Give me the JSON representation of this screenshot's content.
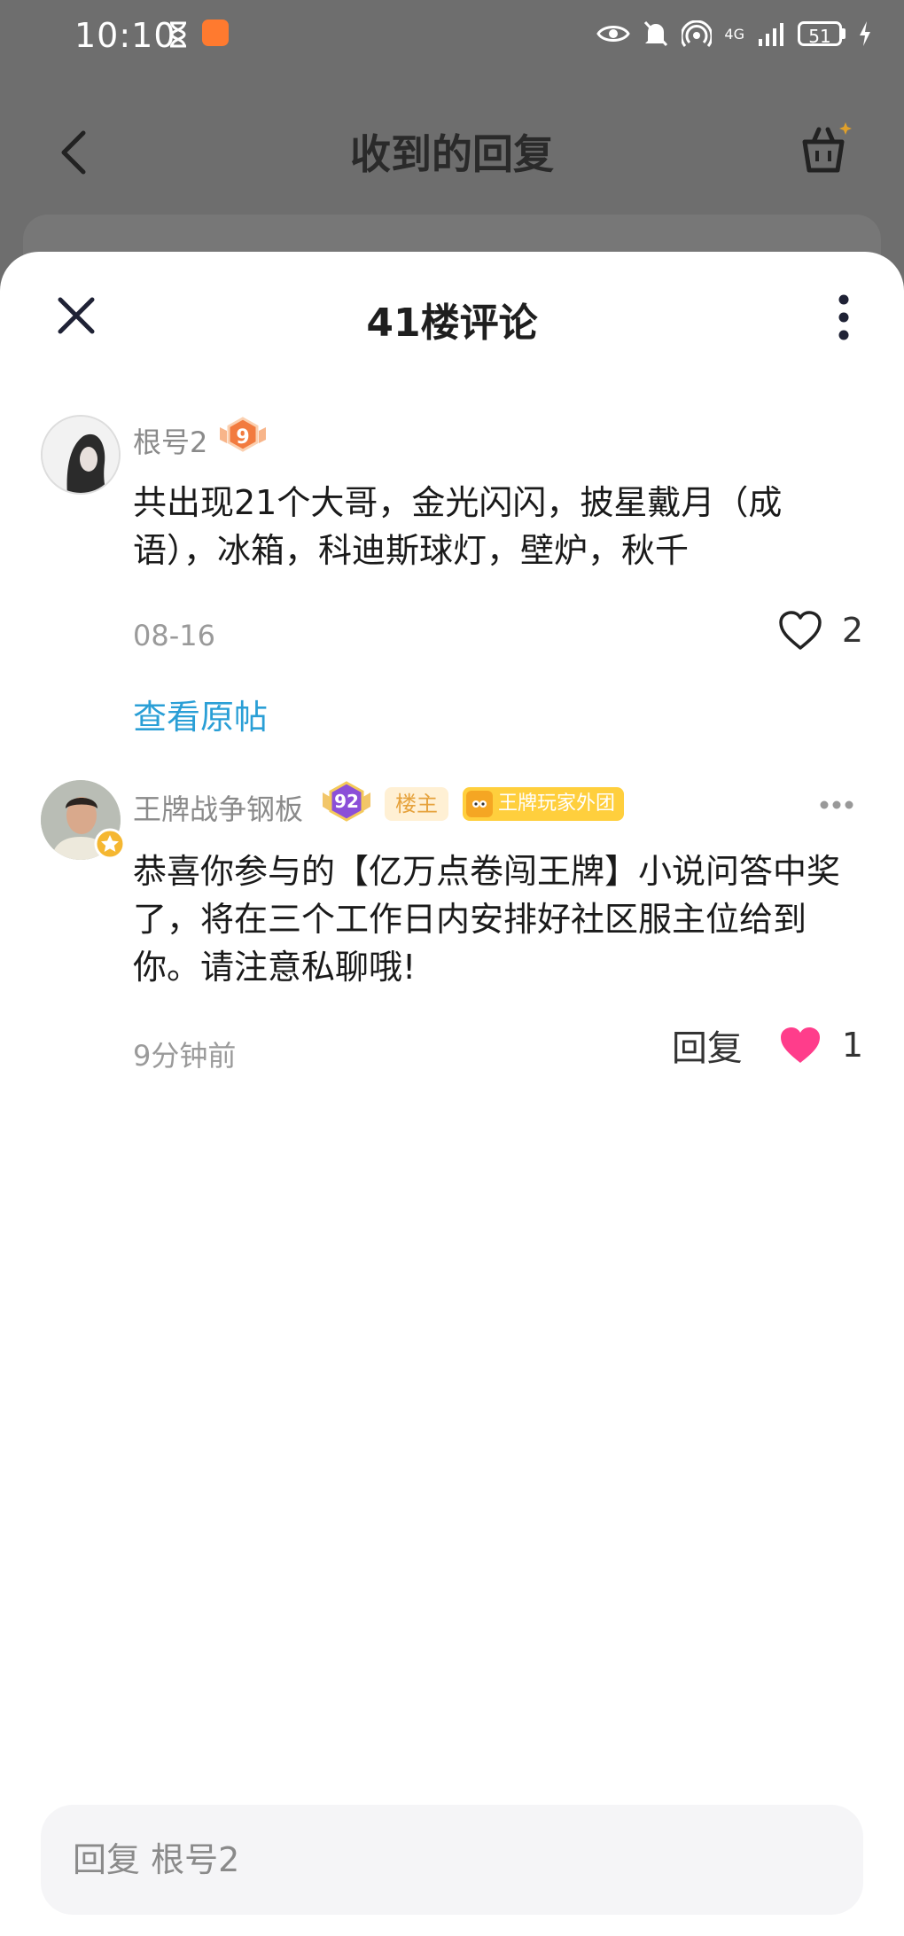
{
  "status_bar": {
    "time": "10:10",
    "battery": "51",
    "network": "4G"
  },
  "background_page": {
    "title": "收到的回复"
  },
  "sheet": {
    "title": "41楼评论"
  },
  "comments": [
    {
      "username": "根号2",
      "level": "9",
      "text": "共出现21个大哥，金光闪闪，披星戴月（成语），冰箱，科迪斯球灯，壁炉，秋千",
      "time": "08-16",
      "likes": "2",
      "liked": false,
      "view_original": "查看原帖"
    },
    {
      "username": "王牌战争钢板",
      "level": "92",
      "owner_tag": "楼主",
      "team_tag": "王牌玩家外团",
      "text": "恭喜你参与的【亿万点卷闯王牌】小说问答中奖了，将在三个工作日内安排好社区服主位给到你。请注意私聊哦!",
      "time": "9分钟前",
      "reply_label": "回复",
      "likes": "1",
      "liked": true
    }
  ],
  "reply_bar": {
    "placeholder": "回复 根号2"
  },
  "colors": {
    "link": "#2a9fd6",
    "like_active": "#ff3d8b",
    "owner_tag_bg": "#fff0d4",
    "team_tag_bg": "#ffcf3d"
  }
}
